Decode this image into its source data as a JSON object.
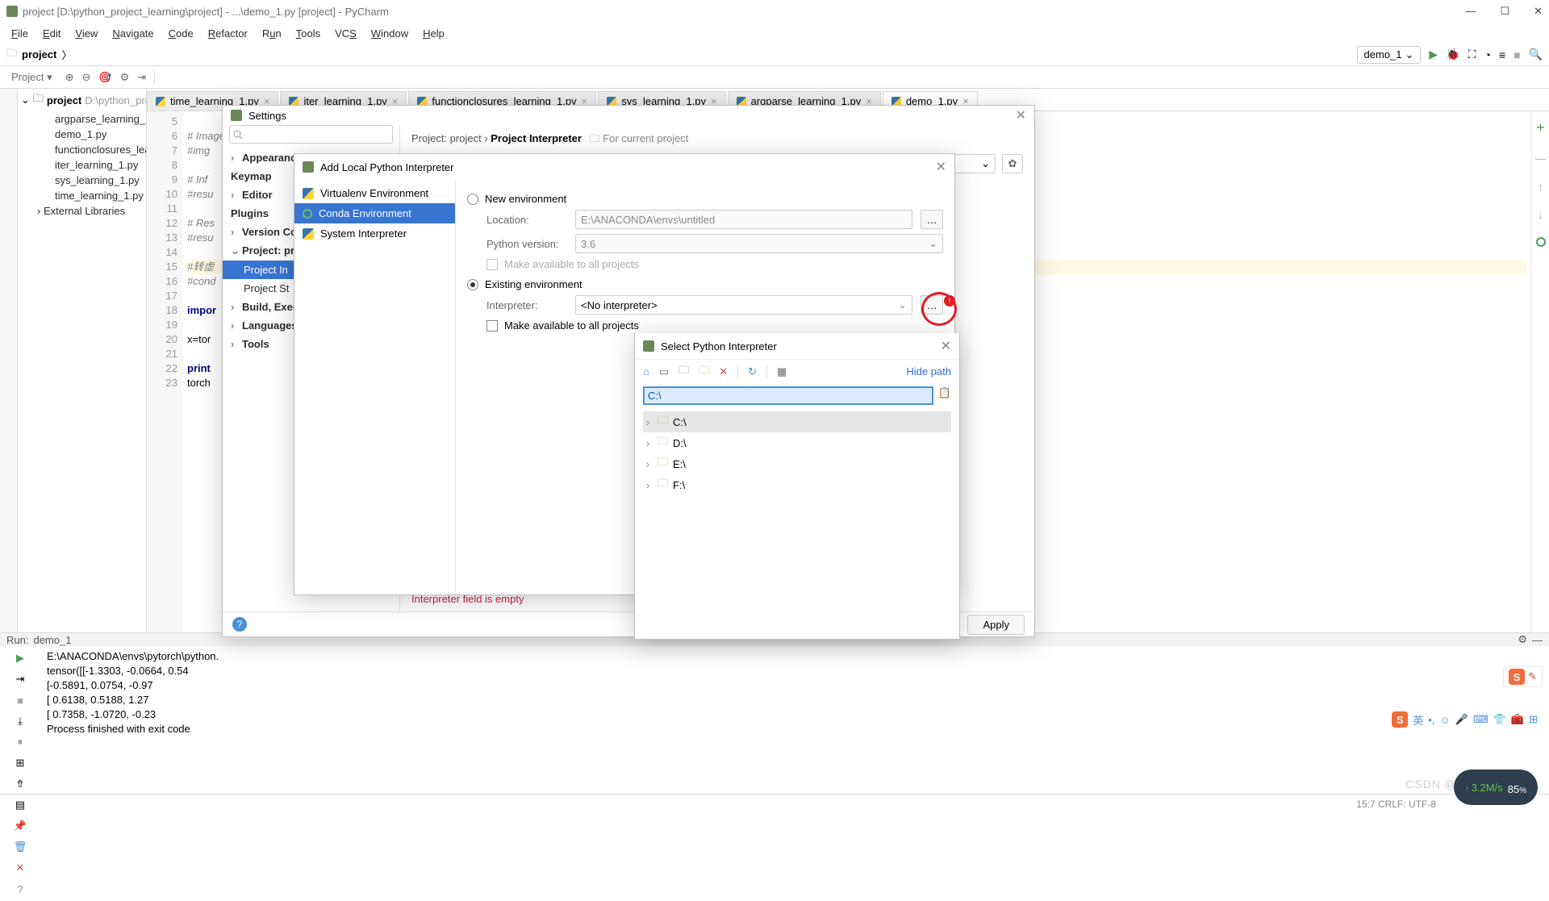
{
  "window": {
    "title": "project [D:\\python_project_learning\\project] - ...\\demo_1.py [project] - PyCharm"
  },
  "menu": [
    "File",
    "Edit",
    "View",
    "Navigate",
    "Code",
    "Refactor",
    "Run",
    "Tools",
    "VCS",
    "Window",
    "Help"
  ],
  "breadcrumb": {
    "project_label": "project"
  },
  "run_config": "demo_1",
  "toolbar": {
    "project_btn": "Project"
  },
  "project_tree": {
    "root_name": "project",
    "root_path": "D:\\python_pro",
    "files": [
      "argparse_learning_1",
      "demo_1.py",
      "functionclosures_lea",
      "iter_learning_1.py",
      "sys_learning_1.py",
      "time_learning_1.py"
    ],
    "external": "External Libraries"
  },
  "tabs": [
    {
      "label": "time_learning_1.py"
    },
    {
      "label": "iter_learning_1.py"
    },
    {
      "label": "functionclosures_learning_1.py"
    },
    {
      "label": "sys_learning_1.py"
    },
    {
      "label": "argparse_learning_1.py"
    },
    {
      "label": "demo_1.py",
      "active": true
    }
  ],
  "gutter_start": 5,
  "gutter_end": 23,
  "code_lines": [
    "",
    "# Images",
    "#img",
    "",
    "# Inf",
    "#resu",
    "",
    "# Res",
    "#resu",
    "",
    "#转虚",
    "#cond",
    "",
    "impor",
    "",
    "x=tor",
    "",
    "print",
    "torch"
  ],
  "run_panel": {
    "label": "Run:",
    "name": "demo_1",
    "out": [
      "E:\\ANACONDA\\envs\\pytorch\\python.",
      "tensor([[-1.3303, -0.0664,  0.54",
      "        [-0.5891,  0.0754, -0.97",
      "        [ 0.6138,  0.5188,  1.27",
      "        [ 0.7358, -1.0720, -0.23",
      "",
      "Process finished with exit code"
    ]
  },
  "settings": {
    "title": "Settings",
    "search_placeholder": "",
    "nav": {
      "appearance": "Appearance",
      "keymap": "Keymap",
      "editor": "Editor",
      "plugins": "Plugins",
      "version": "Version Con",
      "project": "Project: pro",
      "project_interp": "Project In",
      "project_struct": "Project St",
      "build": "Build, Execu",
      "languages": "Languages",
      "tools": "Tools"
    },
    "bc_a": "Project: project",
    "bc_b": "Project Interpreter",
    "bc_hint": "For current project",
    "err": "Interpreter field is empty",
    "apply_btn": "Apply"
  },
  "add_interp": {
    "title": "Add Local Python Interpreter",
    "env_options": [
      "Virtualenv Environment",
      "Conda Environment",
      "System Interpreter"
    ],
    "new_env": "New environment",
    "existing_env": "Existing environment",
    "location_label": "Location:",
    "location_value": "E:\\ANACONDA\\envs\\untitled",
    "pyver_label": "Python version:",
    "pyver_value": "3.6",
    "make_avail": "Make available to all projects",
    "interp_label": "Interpreter:",
    "interp_value": "<No interpreter>"
  },
  "sel_interp": {
    "title": "Select Python Interpreter",
    "hide_path": "Hide path",
    "path_input": "C:\\",
    "drives": [
      "C:\\",
      "D:\\",
      "E:\\",
      "F:\\"
    ]
  },
  "statusline": "15:7  CRLF:  UTF-8",
  "watermark": "CSDN @上帝不会知道",
  "speed": {
    "value": "3.2",
    "unit": "M/s",
    "big": "85"
  },
  "ime_label": "英"
}
